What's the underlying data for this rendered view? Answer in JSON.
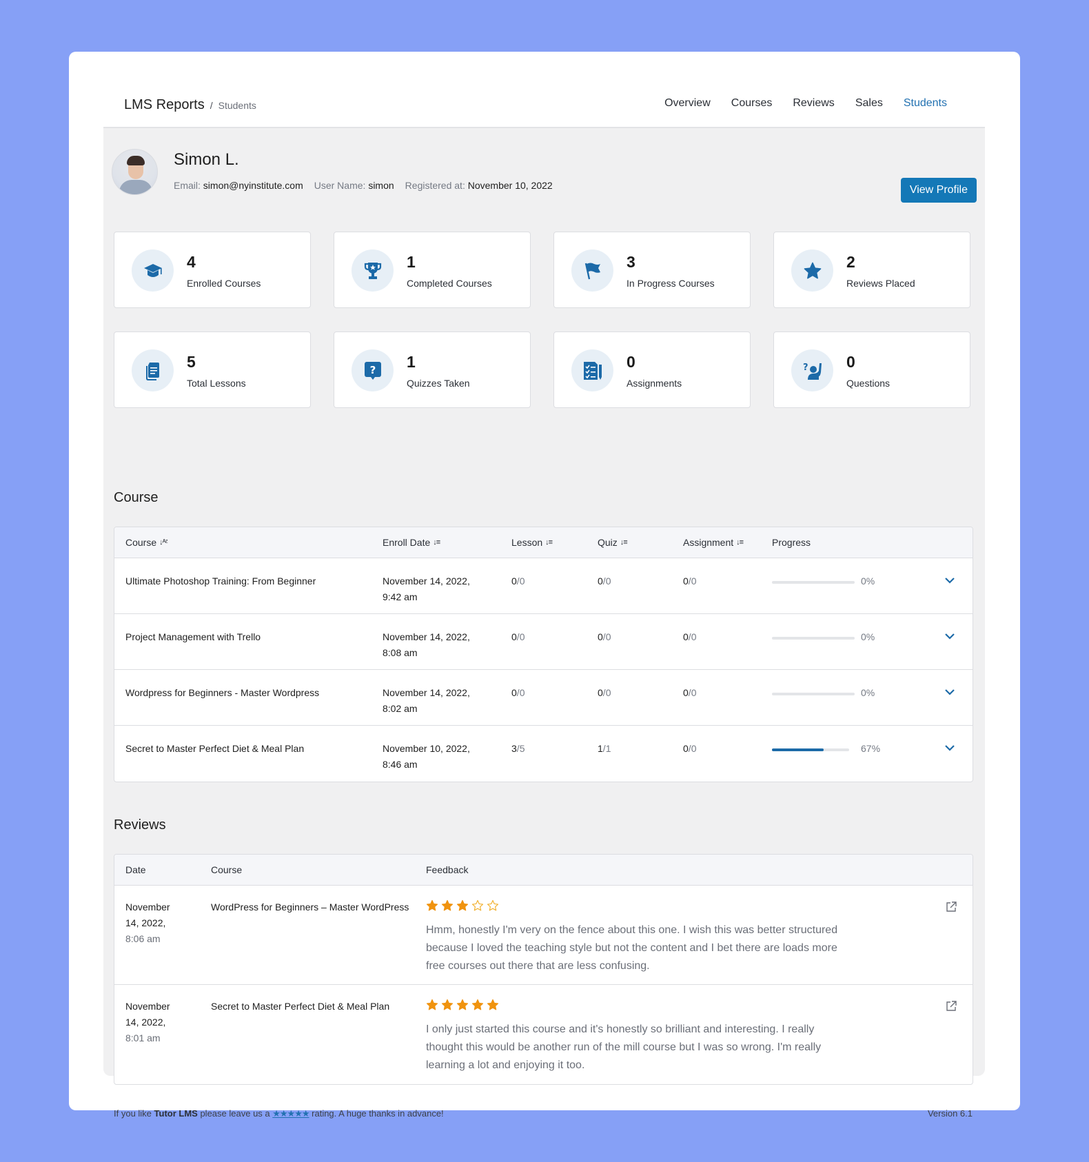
{
  "header": {
    "title": "LMS Reports",
    "separator": "/",
    "breadcrumb": "Students",
    "tabs": [
      {
        "label": "Overview",
        "active": false
      },
      {
        "label": "Courses",
        "active": false
      },
      {
        "label": "Reviews",
        "active": false
      },
      {
        "label": "Sales",
        "active": false
      },
      {
        "label": "Students",
        "active": true
      }
    ]
  },
  "profile": {
    "name": "Simon L.",
    "email_label": "Email:",
    "email": "simon@nyinstitute.com",
    "username_label": "User Name:",
    "username": "simon",
    "registered_label": "Registered at:",
    "registered": "November 10, 2022",
    "view_profile_label": "View Profile"
  },
  "stats": [
    {
      "icon": "graduation-cap-icon",
      "value": "4",
      "label": "Enrolled Courses"
    },
    {
      "icon": "trophy-icon",
      "value": "1",
      "label": "Completed Courses"
    },
    {
      "icon": "flag-icon",
      "value": "3",
      "label": "In Progress Courses"
    },
    {
      "icon": "star-icon",
      "value": "2",
      "label": "Reviews Placed"
    },
    {
      "icon": "document-icon",
      "value": "5",
      "label": "Total Lessons"
    },
    {
      "icon": "question-bubble-icon",
      "value": "1",
      "label": "Quizzes Taken"
    },
    {
      "icon": "checklist-icon",
      "value": "0",
      "label": "Assignments"
    },
    {
      "icon": "raised-hand-question-icon",
      "value": "0",
      "label": "Questions"
    }
  ],
  "courses": {
    "title": "Course",
    "columns": [
      "Course",
      "Enroll Date",
      "Lesson",
      "Quiz",
      "Assignment",
      "Progress"
    ],
    "rows": [
      {
        "course": "Ultimate Photoshop Training: From Beginner",
        "date": "November 14, 2022,",
        "time": "9:42 am",
        "lesson_done": "0",
        "lesson_total": "0",
        "quiz_done": "0",
        "quiz_total": "0",
        "assign_done": "0",
        "assign_total": "0",
        "progress": 0,
        "progress_label": "0%"
      },
      {
        "course": "Project Management with Trello",
        "date": "November 14, 2022,",
        "time": "8:08 am",
        "lesson_done": "0",
        "lesson_total": "0",
        "quiz_done": "0",
        "quiz_total": "0",
        "assign_done": "0",
        "assign_total": "0",
        "progress": 0,
        "progress_label": "0%"
      },
      {
        "course": "Wordpress for Beginners - Master Wordpress",
        "date": "November 14, 2022,",
        "time": "8:02 am",
        "lesson_done": "0",
        "lesson_total": "0",
        "quiz_done": "0",
        "quiz_total": "0",
        "assign_done": "0",
        "assign_total": "0",
        "progress": 0,
        "progress_label": "0%"
      },
      {
        "course": "Secret to Master Perfect Diet & Meal Plan",
        "date": "November 10, 2022,",
        "time": "8:46 am",
        "lesson_done": "3",
        "lesson_total": "5",
        "quiz_done": "1",
        "quiz_total": "1",
        "assign_done": "0",
        "assign_total": "0",
        "progress": 67,
        "progress_label": "67%"
      }
    ]
  },
  "reviews": {
    "title": "Reviews",
    "columns": [
      "Date",
      "Course",
      "Feedback"
    ],
    "rows": [
      {
        "date_line1": "November",
        "date_line2": "14, 2022,",
        "time": "8:06 am",
        "course": "WordPress for Beginners – Master WordPress",
        "rating": 3,
        "max_rating": 5,
        "text": "Hmm, honestly I'm very on the fence about this one. I wish this was better structured because I loved the teaching style but not the content and I bet there are loads more free courses out there that are less confusing."
      },
      {
        "date_line1": "November",
        "date_line2": "14, 2022,",
        "time": "8:01 am",
        "course": "Secret to Master Perfect Diet & Meal Plan",
        "rating": 5,
        "max_rating": 5,
        "text": "I only just started this course and it's honestly so brilliant and interesting. I really thought this would be another run of the mill course but I was so wrong. I'm really learning a lot and enjoying it too."
      }
    ]
  },
  "footer": {
    "prefix": "If you like ",
    "brand": "Tutor LMS",
    "middle": " please leave us a ",
    "stars_link": "★★★★★",
    "suffix": " rating. A huge thanks in advance!",
    "version": "Version 6.1"
  },
  "colors": {
    "accent": "#2271b1",
    "button": "#1478b7",
    "star": "#f0930f",
    "background": "#86a0f6"
  }
}
